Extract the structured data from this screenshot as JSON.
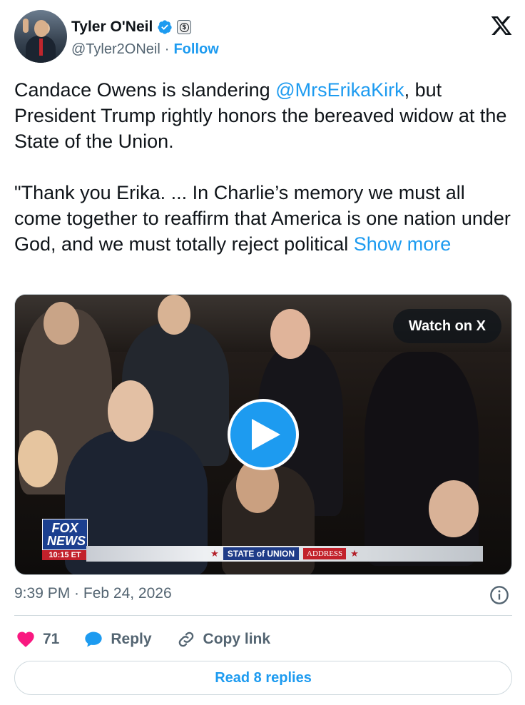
{
  "author": {
    "name": "Tyler O'Neil",
    "handle": "@Tyler2ONeil",
    "separator": "·",
    "follow_label": "Follow",
    "verified_icon": "verified-badge-icon",
    "subscription_icon": "dollar-badge-icon"
  },
  "tweet": {
    "text_part1": "Candace Owens is slandering ",
    "mention": "@MrsErikaKirk",
    "text_part2": ", but President Trump rightly honors the bereaved widow at the State of the Union.\n\n\"Thank you Erika. ... In Charlie’s memory we must all come together to reaffirm that America is one nation under God, and we must totally reject political ",
    "show_more": "Show more"
  },
  "media": {
    "watch_label": "Watch on X",
    "play_icon": "play-icon",
    "fox_logo": "FOX NEWS",
    "fox_time": "10:15 ET",
    "chyron_main": "STATE of UNION",
    "chyron_sub": "ADDRESS"
  },
  "meta": {
    "timestamp": "9:39 PM · Feb 24, 2026"
  },
  "actions": {
    "likes_count": "71",
    "reply_label": "Reply",
    "copy_label": "Copy link"
  },
  "footer": {
    "read_replies": "Read 8 replies"
  },
  "colors": {
    "accent": "#1d9bf0",
    "like": "#f91880",
    "text": "#0f1419",
    "secondary": "#536471"
  }
}
